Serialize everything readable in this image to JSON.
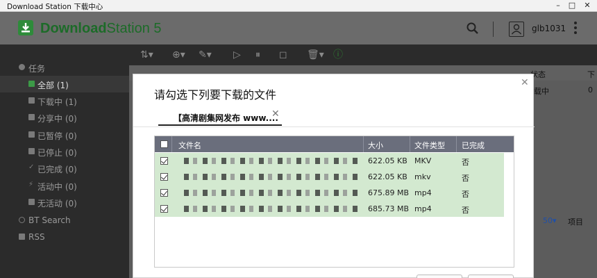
{
  "window": {
    "title": "Download Station 下载中心",
    "min": "–",
    "max": "□",
    "close": "✕"
  },
  "header": {
    "logo_bold": "Download",
    "logo_rest": "Station 5",
    "user": "glb1031"
  },
  "sidebar": {
    "section": "任务",
    "items": [
      {
        "label": "全部 (1)",
        "icon": "grid-icon"
      },
      {
        "label": "下载中 (1)",
        "icon": "download-arrow-icon"
      },
      {
        "label": "分享中 (0)",
        "icon": "upload-arrow-icon"
      },
      {
        "label": "已暂停 (0)",
        "icon": "pause-icon"
      },
      {
        "label": "已停止 (0)",
        "icon": "stop-icon"
      },
      {
        "label": "已完成 (0)",
        "icon": "check-icon"
      },
      {
        "label": "活动中 (0)",
        "icon": "bolt-icon"
      },
      {
        "label": "无活动 (0)",
        "icon": "lock-icon"
      }
    ],
    "bt_search": "BT Search",
    "rss": "RSS"
  },
  "toolbar": {
    "sort": "⇅▾",
    "add": "⊕▾",
    "tools": "✎▾",
    "play": "▷",
    "pause": "⏸",
    "stop": "◻",
    "delete": "🗑▾",
    "info": "ⓘ"
  },
  "background_list": {
    "status_header": "状态",
    "status_value": "载中",
    "last_header": "下",
    "last_value": "0",
    "page_size": "50▾",
    "items_label": "项目"
  },
  "dialog": {
    "title": "请勾选下列要下载的文件",
    "tab_label": "【高清剧集网发布 www....",
    "columns": {
      "name": "文件名",
      "size": "大小",
      "type": "文件类型",
      "done": "已完成"
    },
    "rows": [
      {
        "size": "622.05 KB",
        "type": "MKV",
        "done": "否"
      },
      {
        "size": "622.05 KB",
        "type": "mkv",
        "done": "否"
      },
      {
        "size": "675.89 MB",
        "type": "mp4",
        "done": "否"
      },
      {
        "size": "685.73 MB",
        "type": "mp4",
        "done": "否"
      }
    ]
  },
  "colors": {
    "accent_green": "#2e8b3a",
    "row_green": "#d3e9d0",
    "table_header": "#6a6e7c"
  }
}
